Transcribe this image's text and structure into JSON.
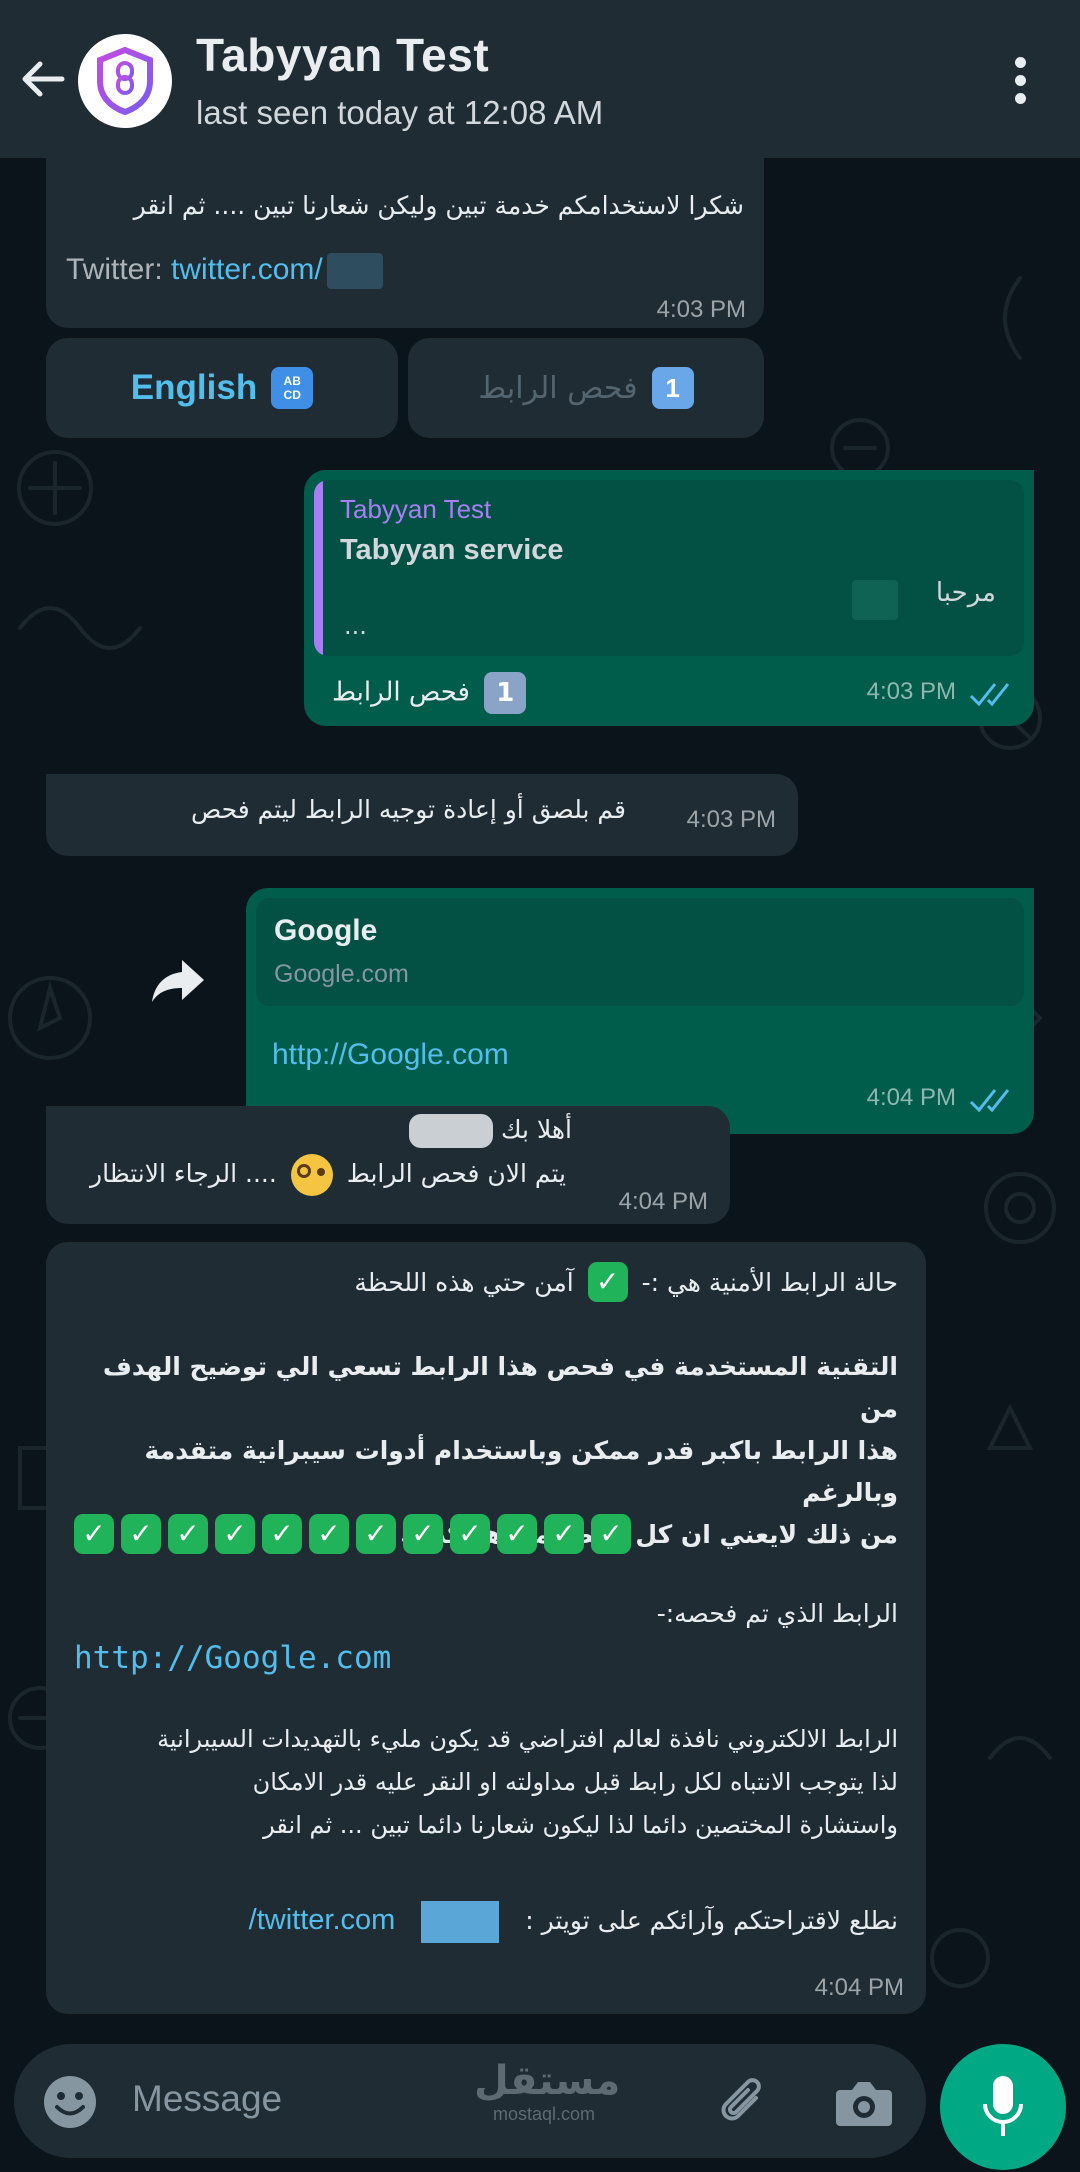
{
  "header": {
    "title": "Tabyyan Test",
    "status": "last seen today at 12:08 AM"
  },
  "messages": {
    "m1": {
      "text": "شكرا لاستخدامكم خدمة تبين وليكن شعارنا تبين .... ثم انقر",
      "twitter_label": "Twitter:",
      "twitter_link": "twitter.com/",
      "time": "4:03 PM"
    },
    "quick_replies": {
      "english": "English",
      "english_badge": "ABCD",
      "check": "فحص الرابط",
      "check_badge": "1"
    },
    "m2": {
      "quote_author": "Tabyyan Test",
      "quote_title": "Tabyyan service",
      "quote_text": "مرحبا",
      "quote_more": "...",
      "badge": "1",
      "text": "فحص الرابط",
      "time": "4:03 PM"
    },
    "m3": {
      "text": "قم بلصق أو إعادة توجيه الرابط ليتم فحص",
      "time": "4:03 PM"
    },
    "m4": {
      "preview_title": "Google",
      "preview_domain": "Google.com",
      "link": "http://Google.com",
      "time": "4:04 PM"
    },
    "m5": {
      "line1": "أهلا بك",
      "line2a": "يتم الان فحص الرابط",
      "line2b": ".... الرجاء الانتظار",
      "time": "4:04 PM"
    },
    "m6": {
      "status_a": "حالة الرابط الأمنية هي :-",
      "status_b": "آمن حتي هذه اللحظة",
      "bold_1": "التقنية المستخدمة في فحص هذا الرابط تسعي الي توضيح الهدف من",
      "bold_2": "هذا الرابط باكبر قدر ممكن وباستخدام أدوات سيبرانية متقدمة وبالرغم",
      "bold_3": "من ذلك لايعني ان كل رابط امن هو كذلك",
      "checks": [
        "✓",
        "✓",
        "✓",
        "✓",
        "✓",
        "✓",
        "✓",
        "✓",
        "✓",
        "✓",
        "✓",
        "✓"
      ],
      "checked_label": "الرابط الذي تم فحصه:-",
      "checked_link": "http://Google.com",
      "para_1": "الرابط الالكتروني نافذة لعالم افتراضي قد يكون مليء بالتهديدات السيبرانية",
      "para_2": "لذا يتوجب الانتباه لكل رابط قبل مداولته او النقر عليه قدر الامكان",
      "para_3": "واستشارة المختصين دائما لذا ليكون شعارنا دائما تبين ... ثم انقر",
      "footer_text": "نطلع لاقتراحتكم وآرائكم على تويتر :",
      "footer_link": "twitter.com/",
      "time": "4:04 PM"
    }
  },
  "input": {
    "placeholder": "Message",
    "watermark_ar": "مستقل",
    "watermark_en": "mostaql.com"
  },
  "colors": {
    "header": "#1f2c34",
    "incoming": "#1f2c34",
    "outgoing": "#005c4b",
    "link": "#53bdeb",
    "mic": "#00a884"
  }
}
